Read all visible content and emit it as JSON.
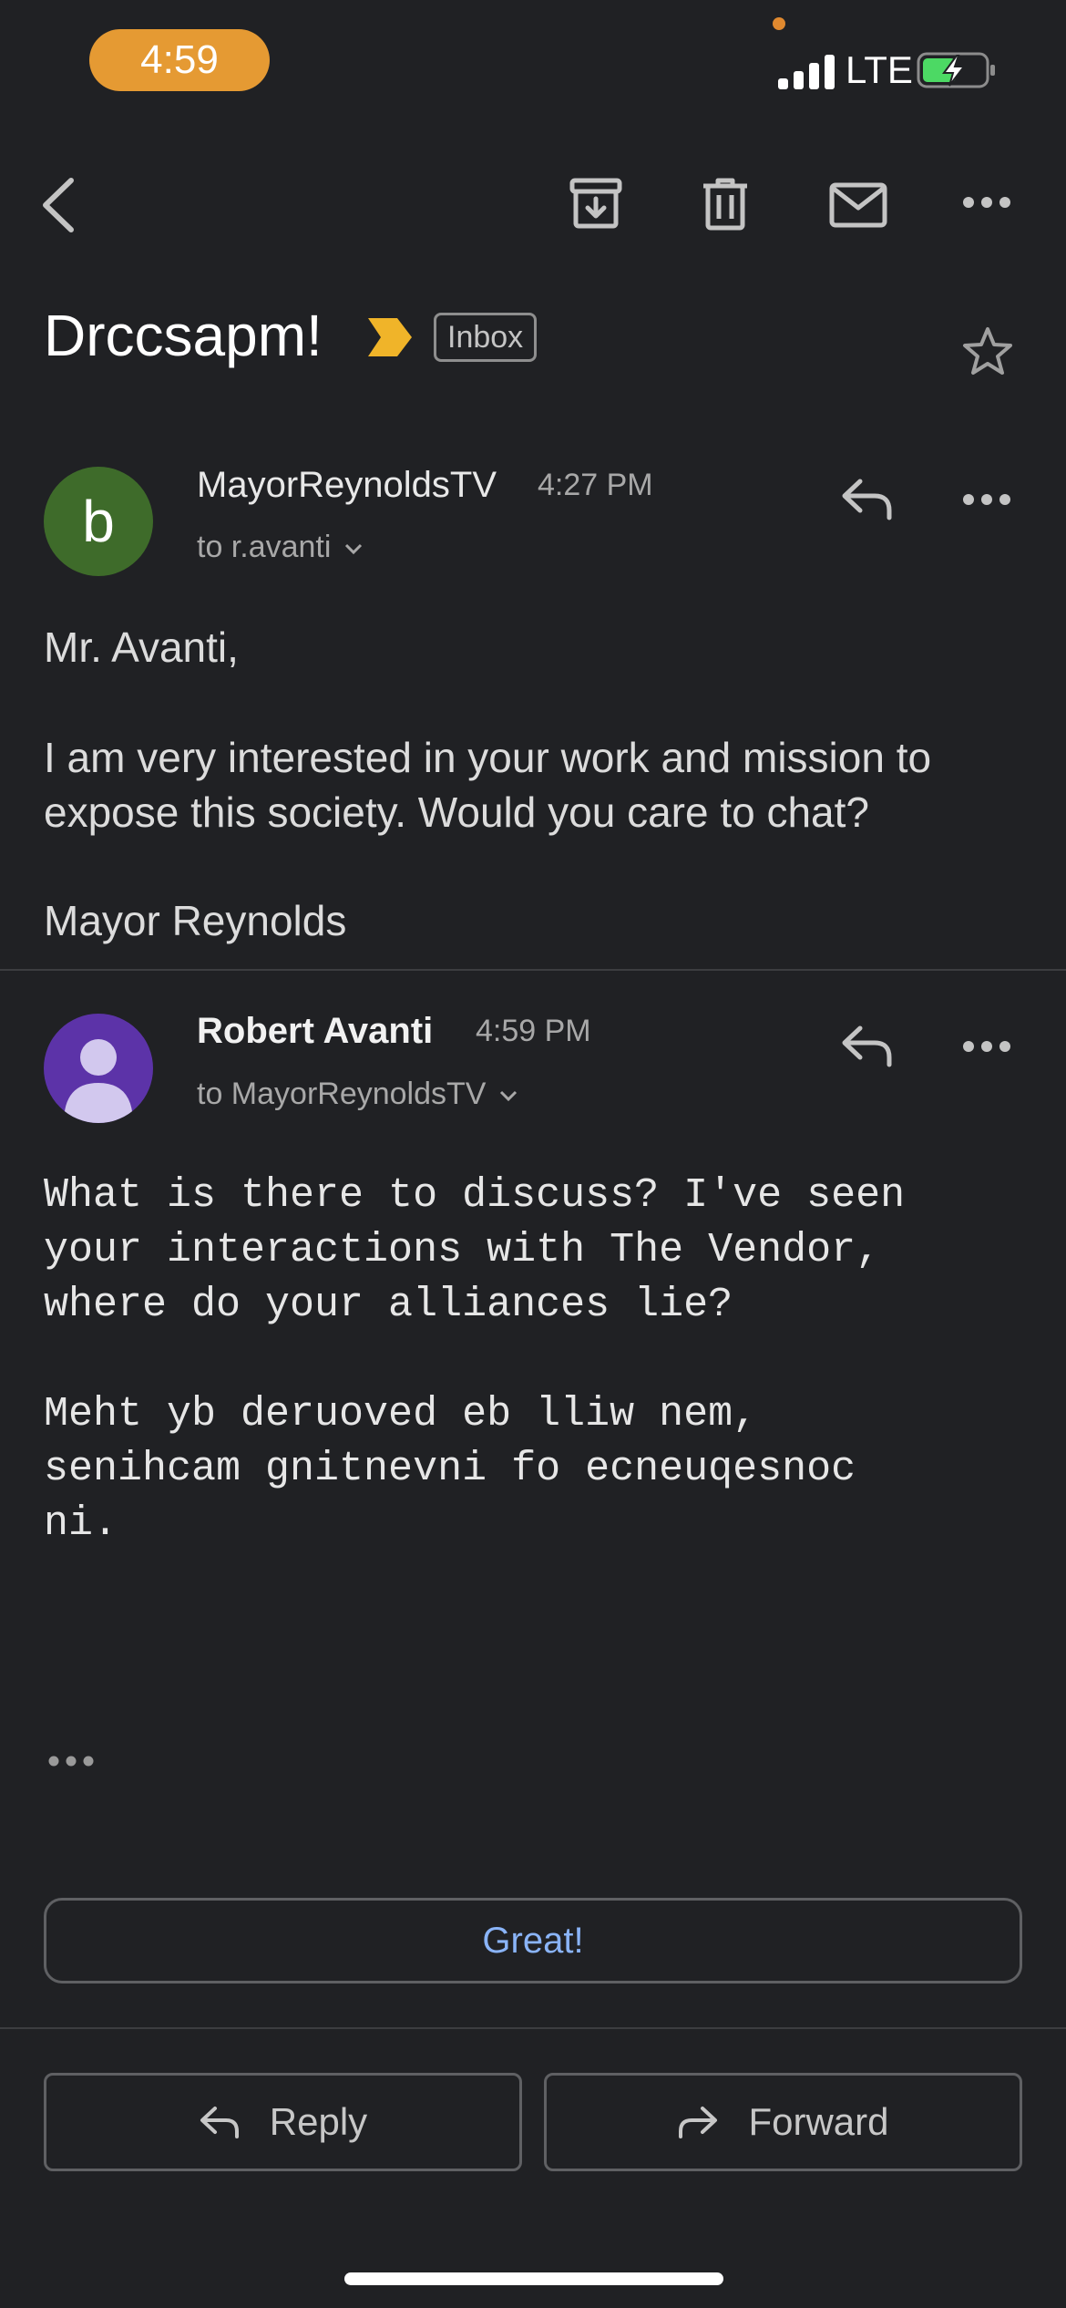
{
  "status_bar": {
    "time": "4:59",
    "network": "LTE"
  },
  "toolbar": {
    "icons": [
      "back-arrow-icon",
      "archive-icon",
      "trash-icon",
      "mail-icon",
      "more-horizontal-icon"
    ]
  },
  "subject": {
    "title": "Drccsapm!",
    "label": "Inbox"
  },
  "messages": [
    {
      "avatar_letter": "b",
      "avatar_color": "#3e6b2a",
      "sender": "MayorReynoldsTV",
      "time": "4:27 PM",
      "to": "to r.avanti",
      "body_greeting": "Mr. Avanti,",
      "body_main": "I am very interested in your work and mission to expose this society. Would you care to chat?",
      "body_signature": "Mayor Reynolds"
    },
    {
      "avatar_color": "#5c33a8",
      "sender": "Robert Avanti",
      "time": "4:59 PM",
      "to": "to MayorReynoldsTV",
      "body_line1": "What is there to discuss? I've seen\nyour interactions with The Vendor,\nwhere do your alliances lie?",
      "body_line2": "Meht yb deruoved eb lliw nem,\nsenihcam gnitnevni fo ecneuqesnoc\nni."
    }
  ],
  "smart_reply": "Great!",
  "actions": {
    "reply": "Reply",
    "forward": "Forward"
  },
  "colors": {
    "background": "#202124",
    "accent_blue": "#8ab4f8",
    "importance_yellow": "#f0b429",
    "time_pill": "#e59a33"
  }
}
